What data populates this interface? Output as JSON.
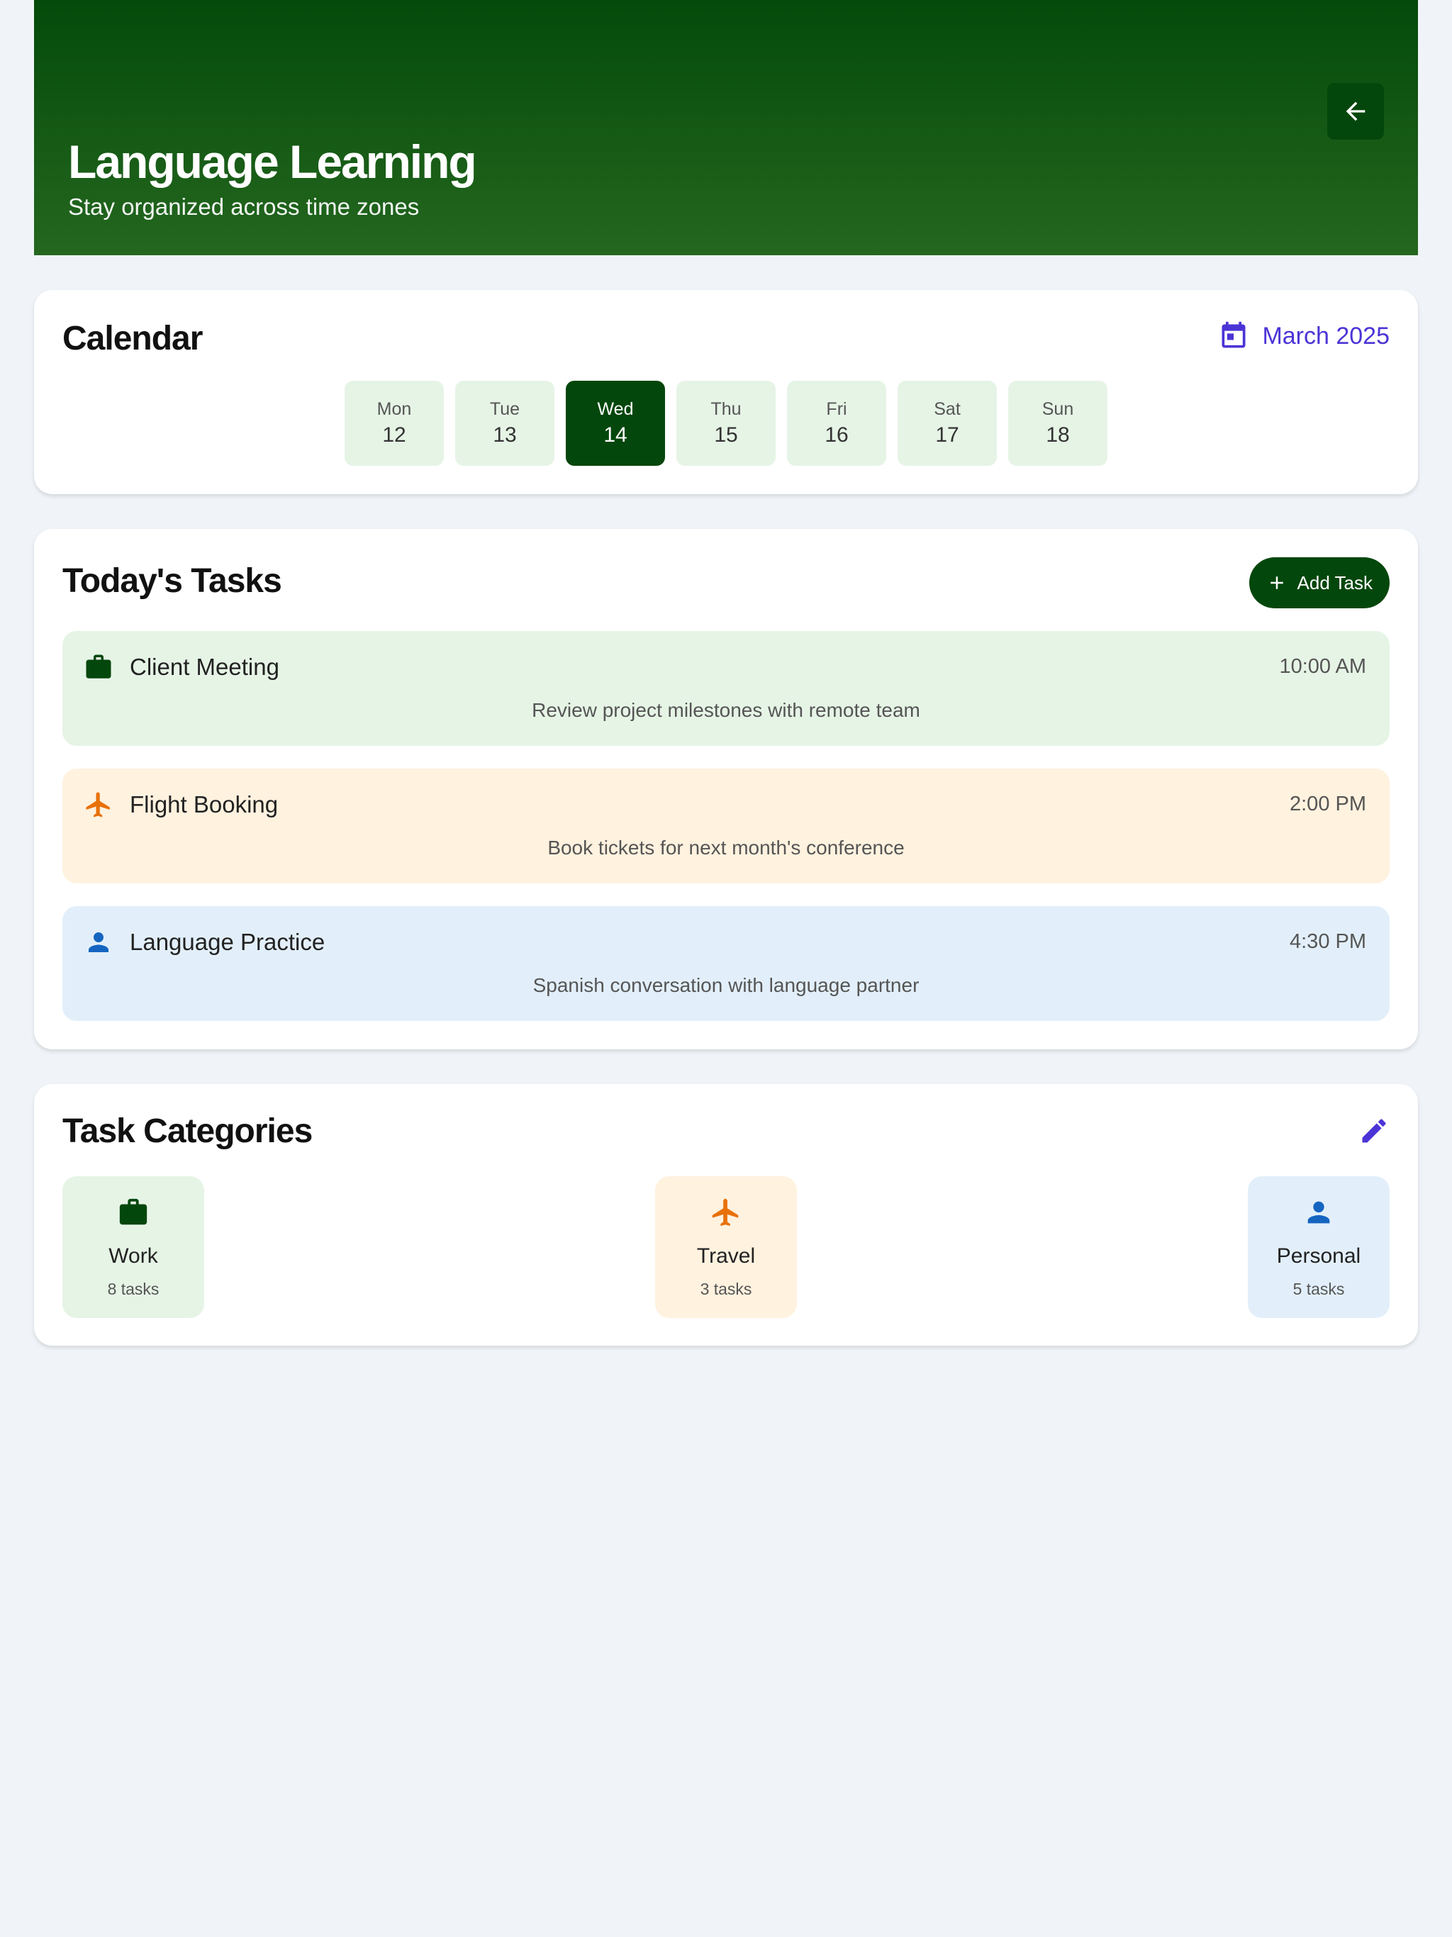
{
  "header": {
    "title": "Language Learning",
    "subtitle": "Stay organized across time zones",
    "back_icon": "arrow-left-icon"
  },
  "calendar": {
    "title": "Calendar",
    "month": "March 2025",
    "month_icon": "calendar-icon",
    "accent_color": "#4b34d6",
    "days": [
      {
        "name": "Mon",
        "date": "12"
      },
      {
        "name": "Tue",
        "date": "13"
      },
      {
        "name": "Wed",
        "date": "14",
        "selected": true
      },
      {
        "name": "Thu",
        "date": "15"
      },
      {
        "name": "Fri",
        "date": "16"
      },
      {
        "name": "Sat",
        "date": "17"
      },
      {
        "name": "Sun",
        "date": "18"
      }
    ]
  },
  "tasks": {
    "title": "Today's Tasks",
    "add_label": "Add Task",
    "items": [
      {
        "icon": "briefcase-icon",
        "name": "Client Meeting",
        "time": "10:00 AM",
        "description": "Review project milestones with remote team",
        "bg": "#e6f4e6",
        "icon_color": "#04470c"
      },
      {
        "icon": "airplane-icon",
        "name": "Flight Booking",
        "time": "2:00 PM",
        "description": "Book tickets for next month's conference",
        "bg": "#fff2df",
        "icon_color": "#e8710a"
      },
      {
        "icon": "person-icon",
        "name": "Language Practice",
        "time": "4:30 PM",
        "description": "Spanish conversation with language partner",
        "bg": "#e2effa",
        "icon_color": "#1565c0"
      }
    ]
  },
  "categories": {
    "title": "Task Categories",
    "edit_icon": "pencil-icon",
    "items": [
      {
        "icon": "briefcase-icon",
        "name": "Work",
        "count": "8 tasks",
        "bg": "#e6f4e6",
        "icon_color": "#04470c"
      },
      {
        "icon": "airplane-icon",
        "name": "Travel",
        "count": "3 tasks",
        "bg": "#fff2df",
        "icon_color": "#e8710a"
      },
      {
        "icon": "person-icon",
        "name": "Personal",
        "count": "5 tasks",
        "bg": "#e2effa",
        "icon_color": "#1565c0"
      }
    ]
  }
}
